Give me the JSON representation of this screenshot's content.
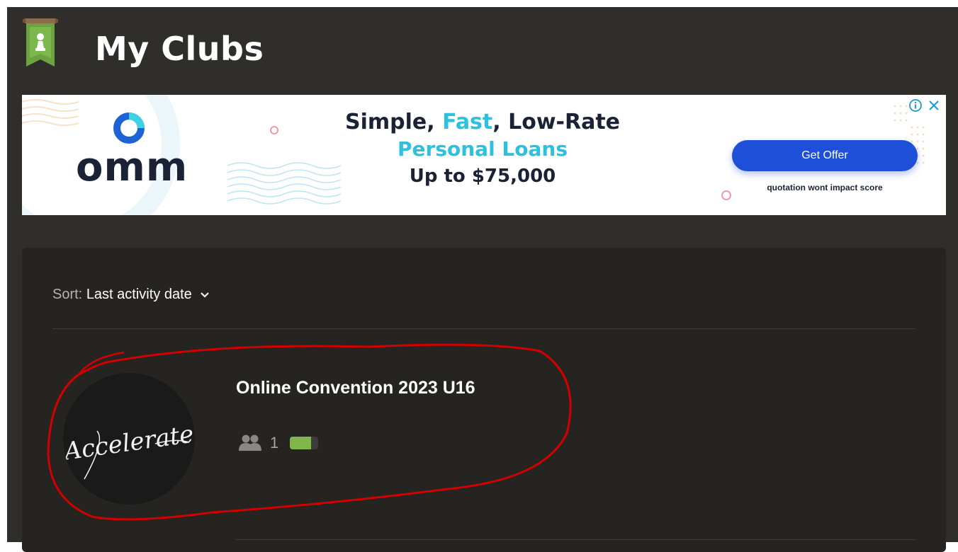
{
  "header": {
    "title": "My Clubs",
    "icon": "club-banner-icon"
  },
  "ad": {
    "brand": "omm",
    "headline_part1": "Simple, ",
    "headline_fast": "Fast",
    "headline_part2": ", Low-Rate",
    "headline_line2": "Personal Loans",
    "headline_line3": "Up to $75,000",
    "cta": "Get Offer",
    "disclaimer": "quotation wont impact score",
    "colors": {
      "accent": "#2ec1dd",
      "button": "#1d4fd8",
      "text": "#1c2236"
    }
  },
  "sort": {
    "label": "Sort:",
    "value": "Last activity date"
  },
  "clubs": [
    {
      "name": "Online Convention 2023 U16",
      "avatar_text": "Accelerate",
      "member_count": "1",
      "activity_level": 0.75
    }
  ],
  "colors": {
    "page_bg": "#302e2b",
    "panel_bg": "#262421",
    "activity_green": "#81b64c",
    "annotation_red": "#d40000"
  }
}
